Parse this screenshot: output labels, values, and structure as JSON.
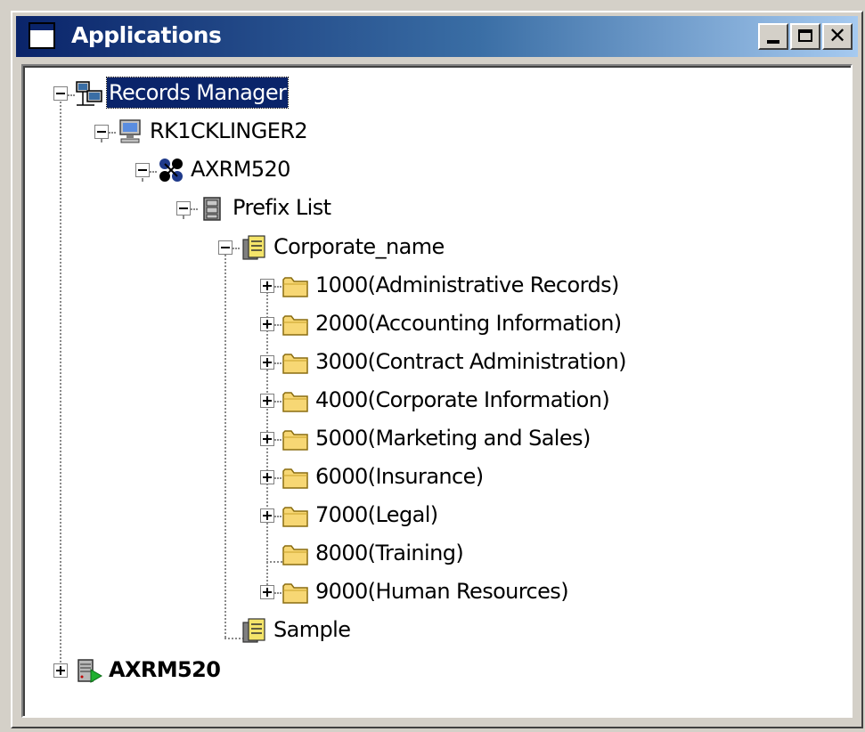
{
  "window": {
    "title": "Applications"
  },
  "tree": {
    "root": {
      "label": "Records Manager"
    },
    "computer": {
      "label": "RK1CKLINGER2"
    },
    "app": {
      "label": "AXRM520"
    },
    "prefix_list": {
      "label": "Prefix List"
    },
    "corporate": {
      "label": "Corporate_name"
    },
    "folders": [
      {
        "label": "1000(Administrative Records)",
        "expandable": true
      },
      {
        "label": "2000(Accounting Information)",
        "expandable": true
      },
      {
        "label": "3000(Contract Administration)",
        "expandable": true
      },
      {
        "label": "4000(Corporate Information)",
        "expandable": true
      },
      {
        "label": "5000(Marketing and Sales)",
        "expandable": true
      },
      {
        "label": "6000(Insurance)",
        "expandable": true
      },
      {
        "label": "7000(Legal)",
        "expandable": true
      },
      {
        "label": "8000(Training)",
        "expandable": false
      },
      {
        "label": "9000(Human Resources)",
        "expandable": true
      }
    ],
    "sample": {
      "label": "Sample"
    },
    "server": {
      "label": "AXRM520"
    }
  },
  "colors": {
    "titlebar_start": "#0a246a",
    "titlebar_end": "#a6caf0",
    "selection": "#0a246a",
    "folder": "#f7d774"
  }
}
